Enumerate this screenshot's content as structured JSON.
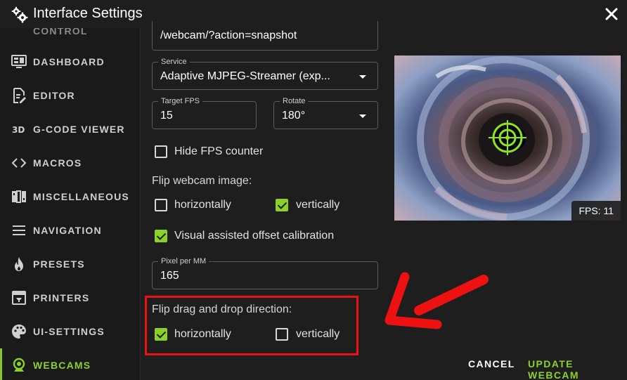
{
  "window": {
    "title": "Interface Settings",
    "icon": "gears-icon",
    "close_icon": "close-icon"
  },
  "sidebar": {
    "partial_label": "CONTROL",
    "items": [
      {
        "label": "DASHBOARD",
        "icon": "monitor-dashboard-icon"
      },
      {
        "label": "EDITOR",
        "icon": "file-edit-icon"
      },
      {
        "label": "G-CODE VIEWER",
        "icon": "3d-icon"
      },
      {
        "label": "MACROS",
        "icon": "code-brackets-icon"
      },
      {
        "label": "MISCELLANEOUS",
        "icon": "misc-blocks-icon"
      },
      {
        "label": "NAVIGATION",
        "icon": "menu-icon"
      },
      {
        "label": "PRESETS",
        "icon": "fire-icon"
      },
      {
        "label": "PRINTERS",
        "icon": "printer-icon"
      },
      {
        "label": "UI-SETTINGS",
        "icon": "palette-icon"
      },
      {
        "label": "WEBCAMS",
        "icon": "webcam-icon",
        "active": true
      }
    ]
  },
  "form": {
    "url_value": "/webcam/?action=snapshot",
    "service": {
      "label": "Service",
      "value": "Adaptive MJPEG-Streamer (exp..."
    },
    "target_fps": {
      "label": "Target FPS",
      "value": "15"
    },
    "rotate": {
      "label": "Rotate",
      "value": "180°"
    },
    "hide_fps": {
      "label": "Hide FPS counter",
      "checked": false
    },
    "flip_image": {
      "title": "Flip webcam image:",
      "horizontal": {
        "label": "horizontally",
        "checked": false
      },
      "vertical": {
        "label": "vertically",
        "checked": true
      }
    },
    "visual_offset": {
      "label": "Visual assisted offset calibration",
      "checked": true
    },
    "pixel_per_mm": {
      "label": "Pixel per MM",
      "value": "165"
    },
    "flip_drag": {
      "title": "Flip drag and drop direction:",
      "horizontal": {
        "label": "horizontally",
        "checked": true
      },
      "vertical": {
        "label": "vertically",
        "checked": false
      }
    }
  },
  "webcam_preview": {
    "fps_text": "FPS: 11",
    "crosshair_color": "#8ce61f"
  },
  "footer": {
    "cancel_label": "CANCEL",
    "update_label": "UPDATE WEBCAM"
  },
  "colors": {
    "accent": "#8bd12a",
    "highlight": "#ee1111",
    "background": "#1e1e1e"
  }
}
